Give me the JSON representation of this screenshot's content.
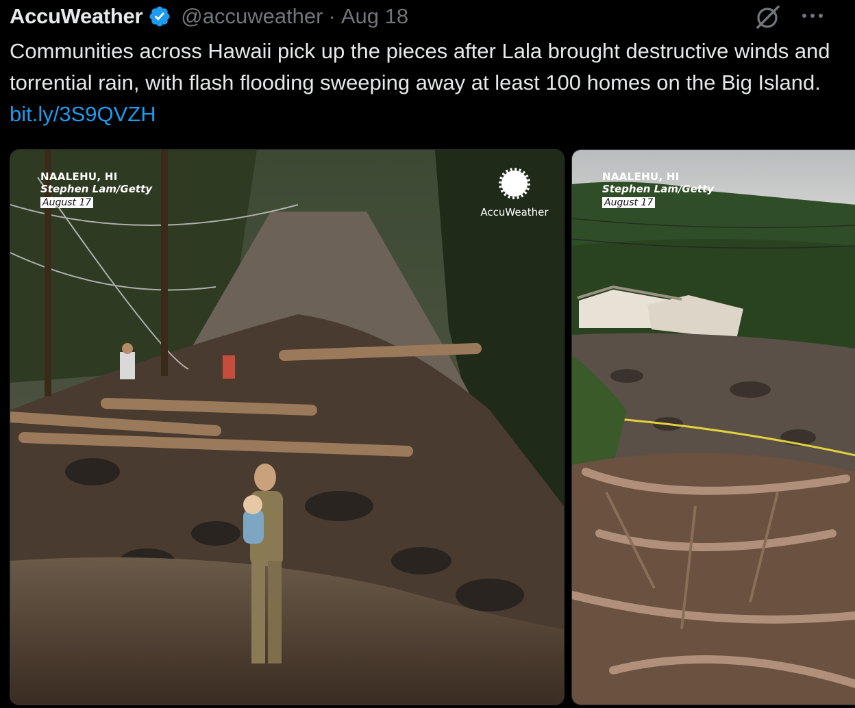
{
  "tweet": {
    "author_name": "AccuWeather",
    "handle": "@accuweather",
    "separator": "·",
    "date": "Aug 18",
    "text": "Communities across Hawaii pick up the pieces after Lala brought destructive winds and torrential rain, with flash flooding sweeping away at least 100 homes on the Big Island.",
    "link": "bit.ly/3S9QVZH"
  },
  "icons": {
    "verified": "verified-badge-icon",
    "grok": "grok-icon",
    "more": "more-options-icon",
    "watermark": "accuweather-sun-logo"
  },
  "media": [
    {
      "location": "NAALEHU, HI",
      "credit": "Stephen Lam/Getty",
      "date": "August 17",
      "watermark": "AccuWeather"
    },
    {
      "location": "NAALEHU, HI",
      "credit": "Stephen Lam/Getty",
      "date": "August 17"
    }
  ],
  "colors": {
    "background": "#000000",
    "text": "#e7e9ea",
    "secondary": "#71767b",
    "link": "#1d9bf0",
    "verified": "#1d9bf0"
  }
}
